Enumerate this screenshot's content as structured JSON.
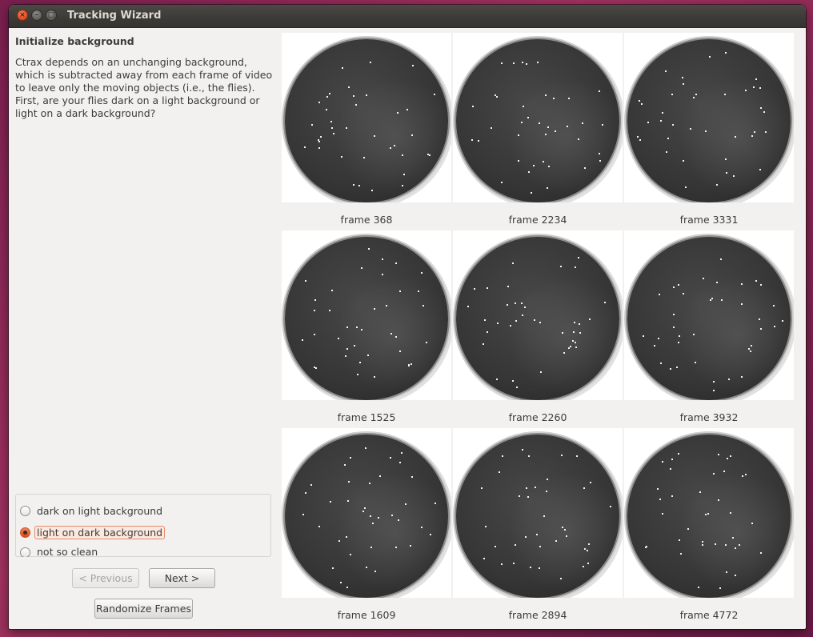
{
  "window": {
    "title": "Tracking Wizard"
  },
  "left_panel": {
    "heading": "Initialize background",
    "description": "Ctrax depends on an unchanging background, which is subtracted away from each frame of video to leave only the moving objects (i.e., the flies). First, are your flies dark on a light background or light on a dark background?"
  },
  "options": [
    {
      "label": "dark on light background",
      "selected": false
    },
    {
      "label": "light on dark background",
      "selected": true
    },
    {
      "label": "not so clean",
      "selected": false
    }
  ],
  "buttons": {
    "previous": "< Previous",
    "next": "Next >",
    "randomize": "Randomize Frames"
  },
  "frames": [
    "frame 368",
    "frame 2234",
    "frame 3331",
    "frame 1525",
    "frame 2260",
    "frame 3932",
    "frame 1609",
    "frame 2894",
    "frame 4772"
  ],
  "colors": {
    "accent": "#dd4814",
    "panel_bg": "#f2f1f0",
    "titlebar": "#3b3a36"
  }
}
